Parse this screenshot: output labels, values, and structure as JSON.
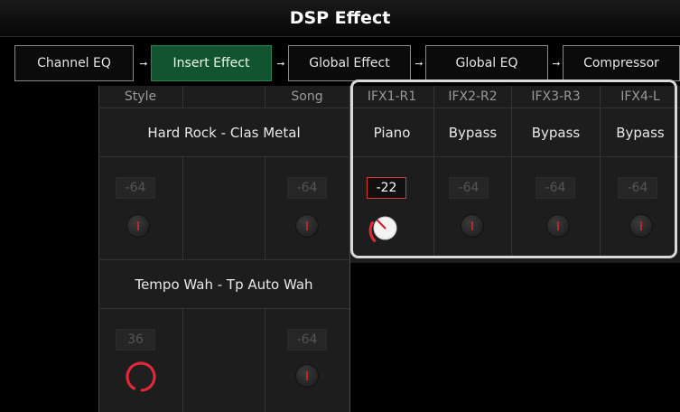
{
  "title": "DSP Effect",
  "flow": [
    "Channel EQ",
    "Insert Effect",
    "Global Effect",
    "Global EQ",
    "Compressor"
  ],
  "headers": {
    "style": "Style",
    "song": "Song",
    "ifx": [
      "IFX1-R1",
      "IFX2-R2",
      "IFX3-R3",
      "IFX4-L"
    ]
  },
  "rows": {
    "row1": {
      "effect": "Hard Rock - Clas Metal",
      "style_value": "-64",
      "song_value": "-64"
    },
    "row2": {
      "effect": "Tempo Wah - Tp Auto Wah",
      "style_value": "36",
      "song_value": "-64"
    }
  },
  "ifx_parts": [
    "Piano",
    "Bypass",
    "Bypass",
    "Bypass"
  ],
  "ifx_values": [
    "-22",
    "-64",
    "-64",
    "-64"
  ],
  "colors": {
    "accent_red": "#e0283a",
    "active_tab": "#125330"
  }
}
